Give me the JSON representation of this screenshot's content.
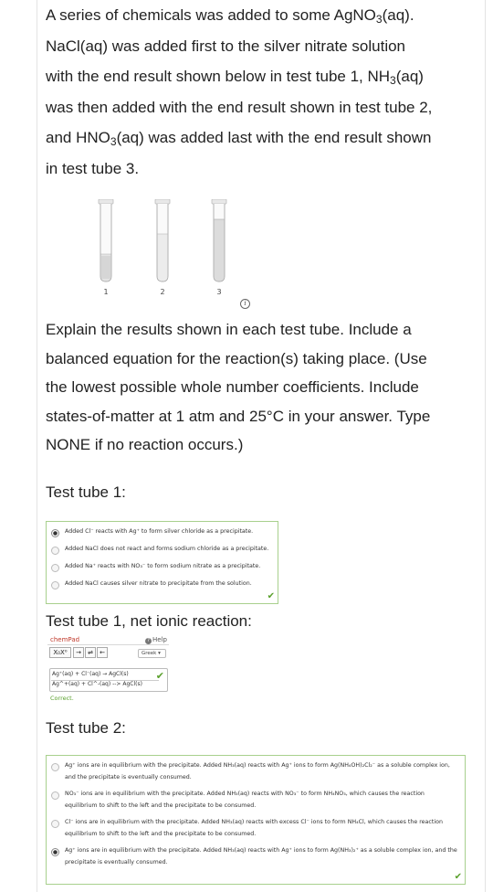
{
  "question": {
    "line1_a": "A series of chemicals was added to some AgNO",
    "line1_sub": "3",
    "line1_b": "(aq).",
    "line2": "NaCl(aq) was added first to the silver nitrate solution",
    "line3_a": "with the end result shown below in test tube 1, NH",
    "line3_sub": "3",
    "line3_b": "(aq)",
    "line4": "was then added with the end result shown in test tube 2,",
    "line5_a": "and HNO",
    "line5_sub": "3",
    "line5_b": "(aq) was added last with the end result shown",
    "line6": "in test tube 3."
  },
  "figure": {
    "tube_labels": [
      "1",
      "2",
      "3"
    ],
    "info_icon": "info-icon"
  },
  "explain": {
    "line1": "Explain the results shown in each test tube. Include a",
    "line2": "balanced equation for the reaction(s) taking place. (Use",
    "line3": "the lowest possible whole number coefficients. Include",
    "line4": "states-of-matter at 1 atm and 25°C in your answer. Type",
    "line5": "NONE if no reaction occurs.)"
  },
  "tube1": {
    "label": "Test tube 1:",
    "choices": [
      {
        "text": "Added Cl⁻ reacts with Ag⁺ to form silver chloride as a precipitate.",
        "selected": true
      },
      {
        "text": "Added NaCl does not react and forms sodium chloride as a precipitate.",
        "selected": false
      },
      {
        "text": "Added Na⁺ reacts with NO₃⁻ to form sodium nitrate as a precipitate.",
        "selected": false
      },
      {
        "text": "Added NaCl causes silver nitrate to precipitate from the solution.",
        "selected": false
      }
    ],
    "check": "✔"
  },
  "net_ionic": {
    "label": "Test tube 1, net ionic reaction:",
    "chempad_title": "chemPad",
    "help_label": "Help",
    "toolbar": {
      "subsup": "X₀X⁰",
      "arrow": "→",
      "equilibrium": "⇌",
      "back": "←"
    },
    "greek_label": "Greek ▾",
    "answer_line1": "Ag⁺(aq) + Cl⁻(aq) → AgCl(s)",
    "answer_line2": "Ag^+(aq) + Cl^-(aq) --> AgCl(s)",
    "check": "✔",
    "correct_label": "Correct."
  },
  "tube2": {
    "label": "Test tube 2:",
    "choices": [
      {
        "line1": "Ag⁺ ions are in equilibrium with the precipitate. Added NH₃(aq) reacts with Ag⁺ ions to form Ag(NH₄OH)₂Cl₂⁻ as a soluble complex ion,",
        "line2": "and the precipitate is eventually consumed.",
        "selected": false
      },
      {
        "line1": "NO₃⁻ ions are in equilibrium with the precipitate. Added NH₃(aq) reacts with NO₃⁻ to form NH₄NO₃, which causes the reaction",
        "line2": "equilibrium to shift to the left and the precipitate to be consumed.",
        "selected": false
      },
      {
        "line1": "Cl⁻ ions are in equilibrium with the precipitate. Added NH₃(aq) reacts with excess Cl⁻ ions to form NH₄Cl, which causes the reaction",
        "line2": "equilibrium to shift to the left and the precipitate to be consumed.",
        "selected": false
      },
      {
        "line1": "Ag⁺ ions are in equilibrium with the precipitate. Added NH₃(aq) reacts with Ag⁺ ions to form Ag(NH₃)₂⁺ as a soluble complex ion, and the",
        "line2": "precipitate is eventually consumed.",
        "selected": true
      }
    ],
    "check": "✔"
  },
  "colors": {
    "border_green": "#a8d08d",
    "check_green": "#5aa02c",
    "chempad_red": "#c0392b"
  }
}
